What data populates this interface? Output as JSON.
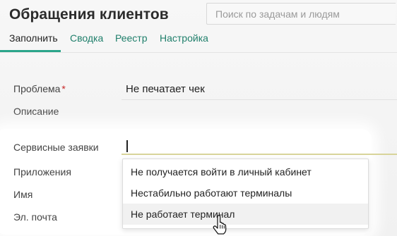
{
  "header": {
    "title": "Обращения клиентов",
    "search_placeholder": "Поиск по задачам и людям"
  },
  "tabs": [
    {
      "label": "Заполнить",
      "active": true
    },
    {
      "label": "Сводка",
      "active": false
    },
    {
      "label": "Реестр",
      "active": false
    },
    {
      "label": "Настройка",
      "active": false
    }
  ],
  "form": {
    "problem": {
      "label": "Проблема",
      "required_mark": "*",
      "value": "Не печатает чек"
    },
    "description": {
      "label": "Описание"
    },
    "service_requests": {
      "label": "Сервисные заявки",
      "value": ""
    },
    "attachments": {
      "label": "Приложения"
    },
    "name": {
      "label": "Имя"
    },
    "email": {
      "label": "Эл. почта"
    }
  },
  "dropdown": {
    "options": [
      "Не получается войти в личный кабинет",
      "Нестабильно работают терминалы",
      "Не работает терминал"
    ],
    "hovered_index": 2
  },
  "colors": {
    "accent": "#2aa58a",
    "tab_link": "#1f7f6b",
    "required": "#c62828"
  },
  "icons": {
    "cursor": "hand-pointer-icon"
  }
}
